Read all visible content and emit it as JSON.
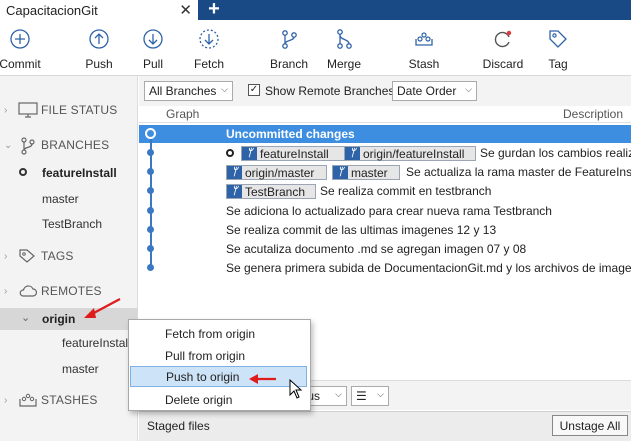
{
  "tab": {
    "title": "CapacitacionGit",
    "close": "✕",
    "add": "+"
  },
  "toolbar": {
    "commit": "Commit",
    "push": "Push",
    "pull": "Pull",
    "fetch": "Fetch",
    "branch": "Branch",
    "merge": "Merge",
    "stash": "Stash",
    "discard": "Discard",
    "tag": "Tag"
  },
  "sidebar": {
    "file_status": "FILE STATUS",
    "branches": "BRANCHES",
    "branch_items": [
      "featureInstall",
      "master",
      "TestBranch"
    ],
    "tags": "TAGS",
    "remotes": "REMOTES",
    "remote_origin": "origin",
    "remote_branches": [
      "featureInstall",
      "master"
    ],
    "stashes": "STASHES"
  },
  "filters": {
    "branches_select": "All Branches",
    "show_remote_label": "Show Remote Branches",
    "show_remote_checked": true,
    "order_select": "Date Order"
  },
  "columns": {
    "graph": "Graph",
    "description": "Description"
  },
  "commits": {
    "uncommitted": "Uncommitted changes",
    "r1_ref1": "featureInstall",
    "r1_ref2": "origin/featureInstall",
    "r1_msg": "Se gurdan los cambios realiza",
    "r2_ref1": "origin/master",
    "r2_ref2": "master",
    "r2_msg": "Se actualiza la rama master de FeatureInsta",
    "r3_ref1": "TestBranch",
    "r3_msg": "Se realiza commit en testbranch",
    "r4_msg": "Se adiciona lo actualizado para crear nueva rama Testbranch",
    "r5_msg": "Se realiza commit de las ultimas imagenes 12 y 13",
    "r6_msg": "Se acutaliza documento .md se agregan imagen 07 y 08",
    "r7_msg": "Se genera primera subida de DocumentacionGit.md y los archivos de imager"
  },
  "bottom": {
    "status_select": "tus",
    "staged_label": "Staged files",
    "unstage_all": "Unstage All"
  },
  "context_menu": {
    "items": [
      "Fetch from origin",
      "Pull from origin",
      "Push to origin",
      "Delete origin"
    ],
    "hovered": "Push to origin"
  },
  "colors": {
    "accent": "#1a4a86",
    "selection": "#3d8ee0",
    "branch_line": "#3a78c4",
    "annotation_arrow": "#e01b1b"
  }
}
